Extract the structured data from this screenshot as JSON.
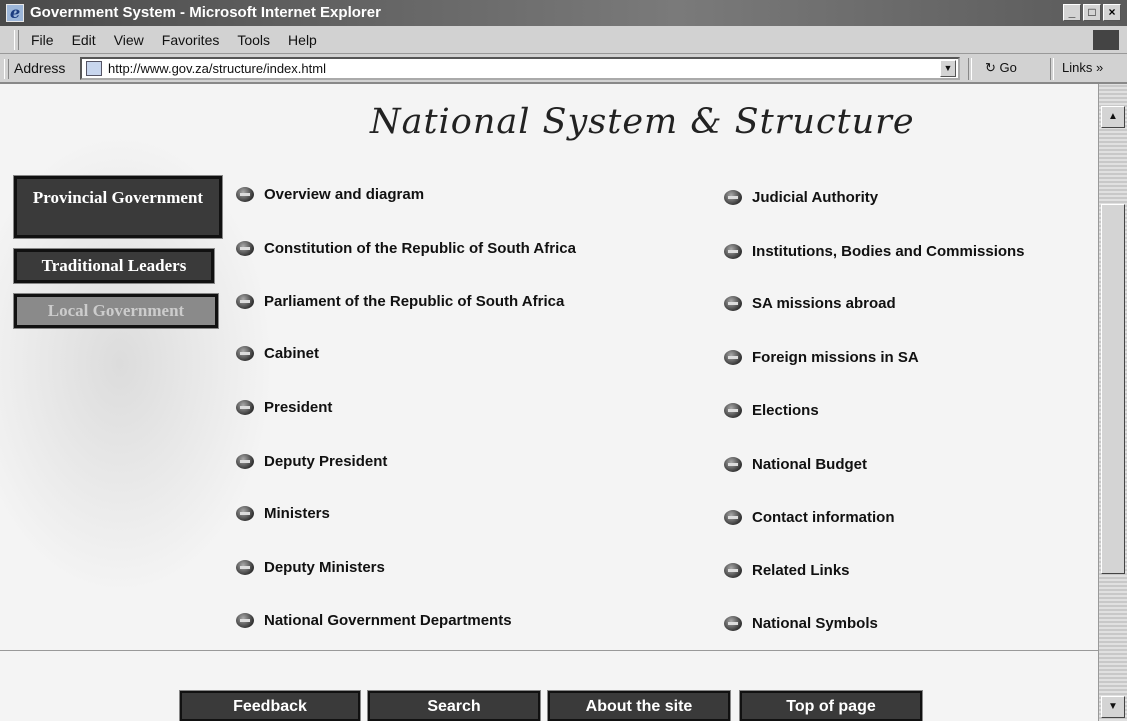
{
  "window": {
    "title": "Government System - Microsoft Internet Explorer",
    "controls": [
      "_",
      "□",
      "×"
    ]
  },
  "menu": [
    "File",
    "Edit",
    "View",
    "Favorites",
    "Tools",
    "Help"
  ],
  "address_bar": {
    "label": "Address",
    "url": "http://www.gov.za/structure/index.html",
    "go_label": "Go",
    "links_label": "Links »"
  },
  "page": {
    "title": "National System & Structure",
    "side_nav": [
      "Provincial Government",
      "Traditional Leaders",
      "Local Government"
    ],
    "left_links": [
      "Overview and diagram",
      "Constitution of the Republic of South Africa",
      "Parliament of the Republic of South Africa",
      "Cabinet",
      "President",
      "Deputy President",
      "Ministers",
      "Deputy Ministers",
      "National Government Departments"
    ],
    "right_links": [
      "Judicial Authority",
      "Institutions, Bodies and Commissions",
      "SA missions abroad",
      "Foreign missions in SA",
      "Elections",
      "National Budget",
      "Contact information",
      "Related Links",
      "National Symbols"
    ],
    "footer_nav": [
      "Feedback",
      "Search",
      "About the site",
      "Top of page"
    ]
  },
  "icons": {
    "bullet": "arrow-bullet-icon",
    "window_icon": "internet-explorer-icon",
    "page_icon": "page-icon"
  },
  "colors": {
    "button_dark": "#3a3a3a",
    "button_disabled": "#8a8a8a",
    "page_background": "#f4f4f4"
  }
}
